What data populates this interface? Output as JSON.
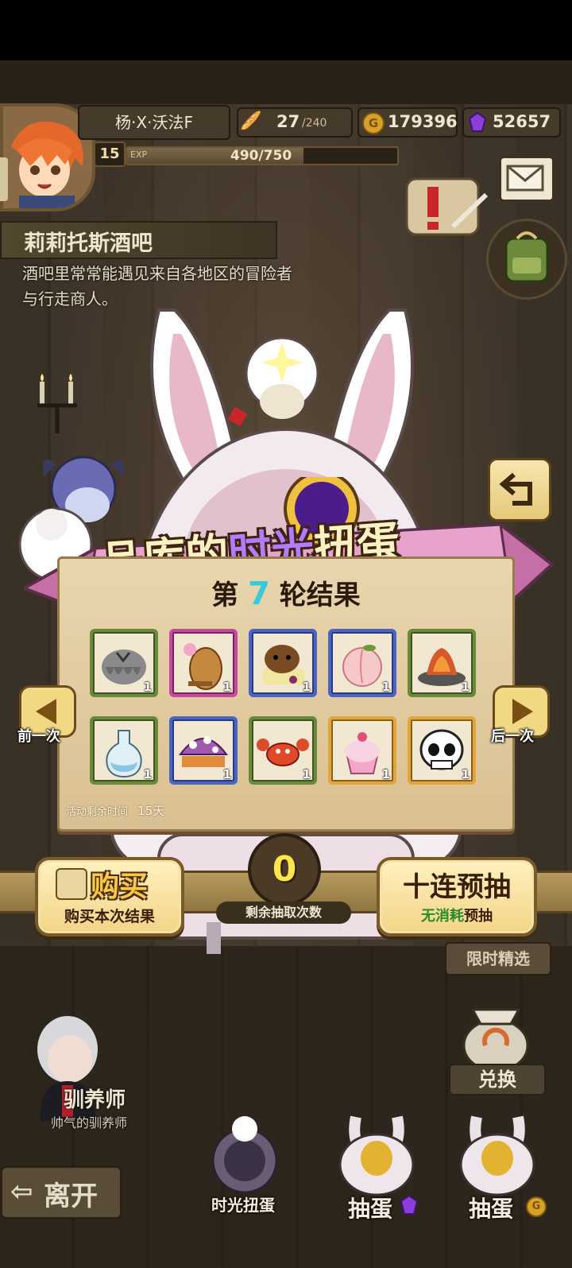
{
  "player": {
    "name": "杨·X·沃法F",
    "level": "15",
    "exp_label": "EXP",
    "exp_text": "490/750",
    "exp_progress": 0.653,
    "stamina": "27",
    "stamina_max": "/240",
    "gold": "179396",
    "gems": "52657"
  },
  "location": {
    "title": "莉莉托斯酒吧",
    "description": "酒吧里常常能遇见来自各地区的冒险者与行走商人。"
  },
  "banner": {
    "title_left": "品库的",
    "title_highlight": "时光",
    "title_right": "扭蛋"
  },
  "results": {
    "round_prefix": "第",
    "round_number": "7",
    "round_suffix": "轮结果",
    "items": [
      {
        "name": "grey-hair-wig",
        "qty": "1",
        "rarity": "green"
      },
      {
        "name": "roast-chicken",
        "qty": "1",
        "rarity": "pink"
      },
      {
        "name": "bear-dessert",
        "qty": "1",
        "rarity": "blue"
      },
      {
        "name": "peach",
        "qty": "1",
        "rarity": "blue"
      },
      {
        "name": "ember-pile",
        "qty": "1",
        "rarity": "green"
      },
      {
        "name": "potion-flask",
        "qty": "1",
        "rarity": "green"
      },
      {
        "name": "spotted-mushroom",
        "qty": "1",
        "rarity": "blue"
      },
      {
        "name": "red-crab",
        "qty": "1",
        "rarity": "green"
      },
      {
        "name": "pink-cupcake",
        "qty": "1",
        "rarity": "gold"
      },
      {
        "name": "skull-mask",
        "qty": "1",
        "rarity": "gold"
      }
    ],
    "event_time_label": "活动剩余时间",
    "event_time_value": "15天"
  },
  "nav": {
    "prev": "前一次",
    "next": "后一次"
  },
  "buy_button": {
    "title": "购买",
    "subtitle": "购买本次结果"
  },
  "counter": {
    "value": "0",
    "label": "剩余抽取次数"
  },
  "preview_button": {
    "title": "十连预抽",
    "subtitle_highlight": "无消耗",
    "subtitle_rest": "预抽"
  },
  "side": {
    "limited": "限时精选",
    "exchange": "兑换"
  },
  "trainer": {
    "title": "驯养师",
    "subtitle": "帅气的驯养师"
  },
  "bottom": {
    "leave": "离开",
    "time_gacha": "时光扭蛋",
    "egg_gem": "抽蛋",
    "egg_gold": "抽蛋"
  },
  "colors": {
    "accent_purple": "#8a3fd6",
    "ribbon_pink": "#d47bb0",
    "counter_yellow": "#ffe44a",
    "round_cyan": "#39c9d8"
  }
}
